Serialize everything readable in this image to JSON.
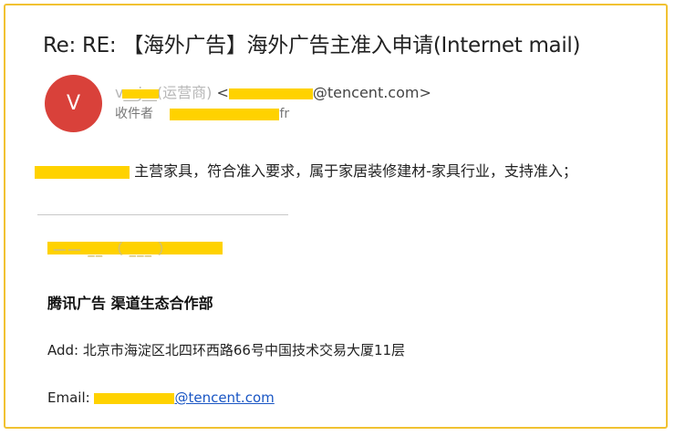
{
  "email": {
    "subject": "Re: RE: 【海外广告】海外广告主准入申请(Internet mail)",
    "avatar_letter": "V",
    "sender": {
      "name_faint": "v__j__(运营商)",
      "open_bracket": "<",
      "address_suffix": "@tencent.com>"
    },
    "recipient": {
      "label": "收件者",
      "suffix": "fr"
    },
    "body_text": "主营家具，符合准入要求，属于家居装修建材-家具行业，支持准入；",
    "signature": {
      "name_faint": "——  __  （ ___ ）",
      "company": "腾讯广告  渠道生态合作部",
      "address": "Add: 北京市海淀区北四环西路66号中国技术交易大厦11层",
      "email_label": "Email: ",
      "email_domain": "@tencent.com"
    }
  },
  "colors": {
    "frame_border": "#f1c232",
    "redaction": "#ffd200",
    "avatar_bg": "#d9413a",
    "link": "#1a56c4"
  }
}
